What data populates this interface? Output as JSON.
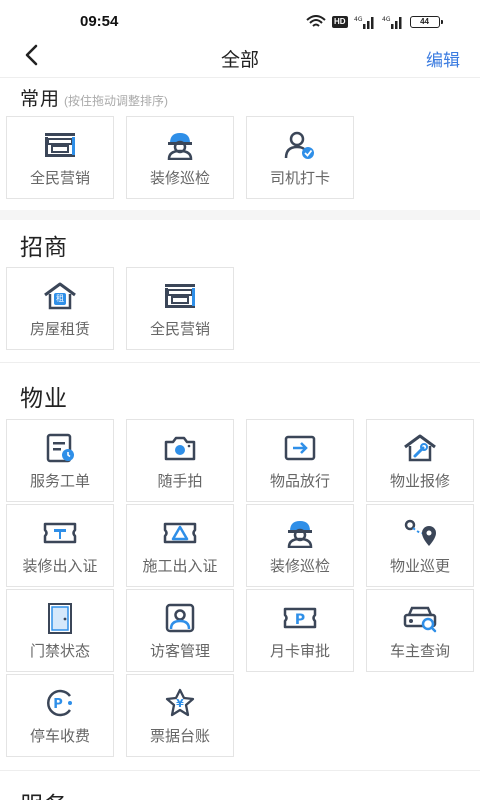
{
  "status_bar": {
    "time": "09:54",
    "hd": "HD",
    "battery": "44"
  },
  "nav": {
    "title": "全部",
    "edit_label": "编辑"
  },
  "colors": {
    "icon_dark": "#3b4658",
    "icon_accent": "#2f8fe8",
    "link": "#3a7be0"
  },
  "sections": {
    "common": {
      "title": "常用",
      "hint": "(按住拖动调整排序)",
      "items": [
        {
          "label": "全民营销",
          "icon": "marketing-icon"
        },
        {
          "label": "装修巡检",
          "icon": "renovation-worker-icon"
        },
        {
          "label": "司机打卡",
          "icon": "driver-checkin-icon"
        }
      ]
    },
    "investment": {
      "title": "招商",
      "items": [
        {
          "label": "房屋租赁",
          "icon": "house-rent-icon",
          "badge": "租"
        },
        {
          "label": "全民营销",
          "icon": "marketing-icon"
        }
      ]
    },
    "property": {
      "title": "物业",
      "items": [
        {
          "label": "服务工单",
          "icon": "work-order-icon"
        },
        {
          "label": "随手拍",
          "icon": "camera-icon"
        },
        {
          "label": "物品放行",
          "icon": "item-release-icon"
        },
        {
          "label": "物业报修",
          "icon": "repair-icon"
        },
        {
          "label": "装修出入证",
          "icon": "renovation-pass-icon"
        },
        {
          "label": "施工出入证",
          "icon": "construction-pass-icon"
        },
        {
          "label": "装修巡检",
          "icon": "renovation-worker-icon"
        },
        {
          "label": "物业巡更",
          "icon": "patrol-route-icon"
        },
        {
          "label": "门禁状态",
          "icon": "door-access-icon"
        },
        {
          "label": "访客管理",
          "icon": "visitor-icon"
        },
        {
          "label": "月卡审批",
          "icon": "parking-card-icon",
          "badge": "P"
        },
        {
          "label": "车主查询",
          "icon": "car-search-icon"
        },
        {
          "label": "停车收费",
          "icon": "parking-fee-icon",
          "badge": "P"
        },
        {
          "label": "票据台账",
          "icon": "receipt-ledger-icon",
          "badge": "¥"
        }
      ]
    },
    "service": {
      "title": "服务"
    }
  }
}
